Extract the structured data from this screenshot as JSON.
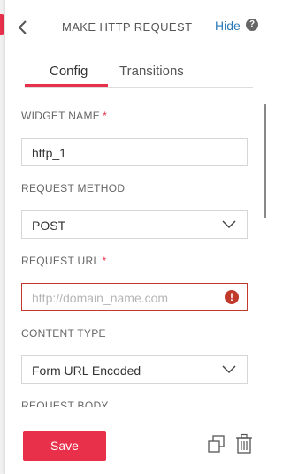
{
  "header": {
    "title": "MAKE HTTP REQUEST",
    "hide_label": "Hide",
    "help_glyph": "?"
  },
  "tabs": [
    {
      "label": "Config",
      "active": true
    },
    {
      "label": "Transitions",
      "active": false
    }
  ],
  "fields": {
    "widget_name": {
      "label": "WIDGET NAME",
      "required": "*",
      "value": "http_1"
    },
    "request_method": {
      "label": "REQUEST METHOD",
      "value": "POST"
    },
    "request_url": {
      "label": "REQUEST URL",
      "required": "*",
      "placeholder": "http://domain_name.com",
      "error_glyph": "!"
    },
    "content_type": {
      "label": "CONTENT TYPE",
      "value": "Form URL Encoded"
    },
    "request_body": {
      "label": "REQUEST BODY"
    }
  },
  "footer": {
    "save_label": "Save"
  },
  "colors": {
    "accent": "#e8304a",
    "link": "#2a7ab8",
    "error": "#c0392b"
  },
  "icons": [
    "back-chevron-icon",
    "help-icon",
    "chevron-down-icon",
    "error-icon",
    "copy-icon",
    "trash-icon"
  ]
}
